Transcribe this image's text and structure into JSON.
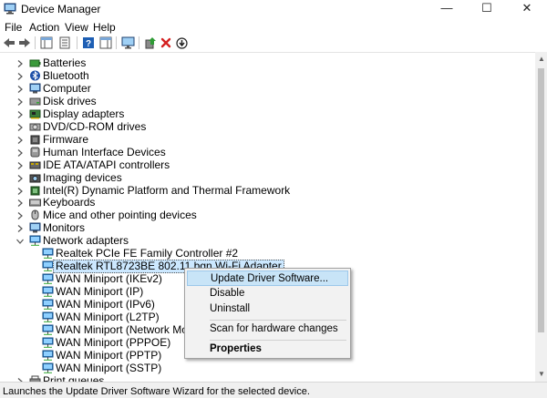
{
  "window": {
    "title": "Device Manager",
    "minimize_glyph": "—",
    "maximize_glyph": "☐",
    "close_glyph": "✕"
  },
  "menu": [
    "File",
    "Action",
    "View",
    "Help"
  ],
  "tree": [
    {
      "label": "Batteries",
      "icon": "battery-icon"
    },
    {
      "label": "Bluetooth",
      "icon": "bluetooth-icon"
    },
    {
      "label": "Computer",
      "icon": "computer-icon"
    },
    {
      "label": "Disk drives",
      "icon": "disk-drive-icon"
    },
    {
      "label": "Display adapters",
      "icon": "display-adapter-icon"
    },
    {
      "label": "DVD/CD-ROM drives",
      "icon": "dvd-drive-icon"
    },
    {
      "label": "Firmware",
      "icon": "firmware-icon"
    },
    {
      "label": "Human Interface Devices",
      "icon": "hid-icon"
    },
    {
      "label": "IDE ATA/ATAPI controllers",
      "icon": "ide-controller-icon"
    },
    {
      "label": "Imaging devices",
      "icon": "camera-icon"
    },
    {
      "label": "Intel(R) Dynamic Platform and Thermal Framework",
      "icon": "chip-icon"
    },
    {
      "label": "Keyboards",
      "icon": "keyboard-icon"
    },
    {
      "label": "Mice and other pointing devices",
      "icon": "mouse-icon"
    },
    {
      "label": "Monitors",
      "icon": "monitor-icon"
    },
    {
      "label": "Network adapters",
      "icon": "network-adapter-icon",
      "expanded": true
    },
    {
      "label": "Realtek PCIe FE Family Controller #2",
      "icon": "network-adapter-icon",
      "child": true
    },
    {
      "label": "Realtek RTL8723BE 802.11 bgn Wi-Fi Adapter",
      "icon": "network-adapter-icon",
      "child": true,
      "selected": true
    },
    {
      "label": "WAN Miniport (IKEv2)",
      "icon": "network-adapter-icon",
      "child": true
    },
    {
      "label": "WAN Miniport (IP)",
      "icon": "network-adapter-icon",
      "child": true
    },
    {
      "label": "WAN Miniport (IPv6)",
      "icon": "network-adapter-icon",
      "child": true
    },
    {
      "label": "WAN Miniport (L2TP)",
      "icon": "network-adapter-icon",
      "child": true
    },
    {
      "label": "WAN Miniport (Network Monitor)",
      "icon": "network-adapter-icon",
      "child": true
    },
    {
      "label": "WAN Miniport (PPPOE)",
      "icon": "network-adapter-icon",
      "child": true
    },
    {
      "label": "WAN Miniport (PPTP)",
      "icon": "network-adapter-icon",
      "child": true
    },
    {
      "label": "WAN Miniport (SSTP)",
      "icon": "network-adapter-icon",
      "child": true
    },
    {
      "label": "Print queues",
      "icon": "printer-icon"
    }
  ],
  "context_menu": {
    "update_driver": "Update Driver Software...",
    "disable": "Disable",
    "uninstall": "Uninstall",
    "scan": "Scan for hardware changes",
    "properties": "Properties"
  },
  "status": "Launches the Update Driver Software Wizard for the selected device.",
  "colors": {
    "selection": "#cce8ff",
    "menu_highlight": "#c8e4f7",
    "accent_blue": "#1e73c8",
    "delete_red": "#d42020",
    "update_green": "#2e9b35"
  }
}
